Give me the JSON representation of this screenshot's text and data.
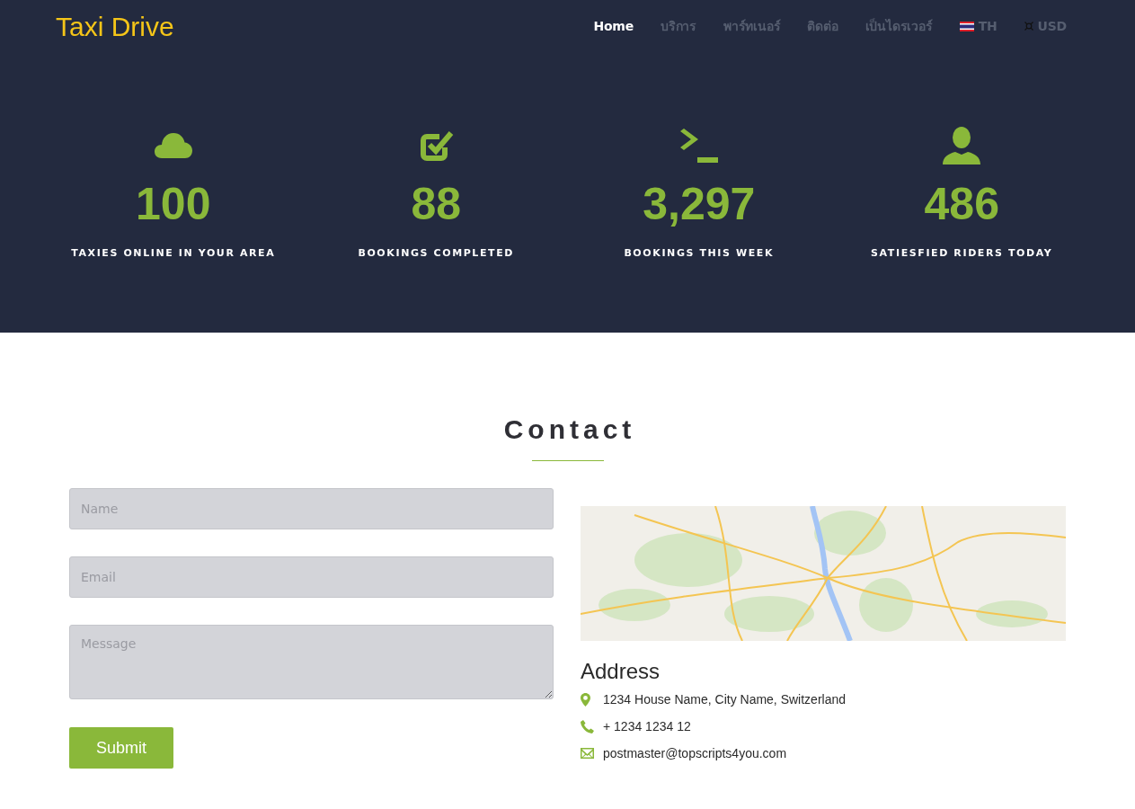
{
  "header": {
    "logo": "Taxi Drive",
    "nav": [
      {
        "label": "Home",
        "kind": "link",
        "selected": true
      },
      {
        "label": "บริการ",
        "kind": "link",
        "selected": false
      },
      {
        "label": "พาร์ทเนอร์",
        "kind": "link",
        "selected": false
      },
      {
        "label": "ติดต่อ",
        "kind": "link",
        "selected": false
      },
      {
        "label": "เป็นไดรเวอร์",
        "kind": "link",
        "selected": false
      },
      {
        "label": "TH",
        "kind": "language",
        "selected": false
      },
      {
        "label": "USD",
        "kind": "currency",
        "selected": false
      }
    ]
  },
  "stats": [
    {
      "value": "100",
      "label": "TAXIES ONLINE IN YOUR AREA"
    },
    {
      "value": "88",
      "label": "BOOKINGS COMPLETED"
    },
    {
      "value": "3,297",
      "label": "BOOKINGS THIS WEEK"
    },
    {
      "value": "486",
      "label": "SATIESFIED RIDERS TODAY"
    }
  ],
  "contact": {
    "title": "Contact",
    "form": {
      "fields": [
        {
          "kind": "input",
          "placeholder": "Name"
        },
        {
          "kind": "input",
          "placeholder": "Email"
        },
        {
          "kind": "textarea",
          "placeholder": "Message"
        }
      ],
      "submit": "Submit"
    },
    "address": {
      "title": "Address",
      "items": [
        {
          "kind": "location",
          "text": "1234 House Name, City Name, Switzerland"
        },
        {
          "kind": "phone",
          "text": "+ 1234 1234 12"
        },
        {
          "kind": "email",
          "text": "postmaster@topscripts4you.com"
        }
      ]
    }
  }
}
